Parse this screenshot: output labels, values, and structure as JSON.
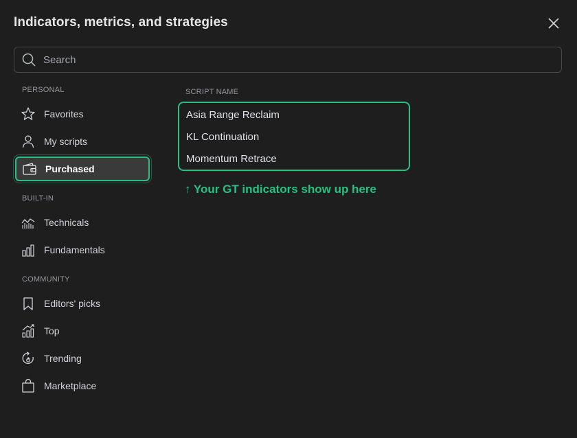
{
  "dialog": {
    "title": "Indicators, metrics, and strategies",
    "close_icon": "close-icon"
  },
  "search": {
    "placeholder": "Search",
    "value": ""
  },
  "sidebar": {
    "sections": [
      {
        "label": "PERSONAL",
        "items": [
          {
            "label": "Favorites",
            "icon": "star-icon"
          },
          {
            "label": "My scripts",
            "icon": "user-icon"
          },
          {
            "label": "Purchased",
            "icon": "wallet-icon",
            "active": true
          }
        ]
      },
      {
        "label": "BUILT-IN",
        "items": [
          {
            "label": "Technicals",
            "icon": "chart-line-icon"
          },
          {
            "label": "Fundamentals",
            "icon": "bar-chart-icon"
          }
        ]
      },
      {
        "label": "COMMUNITY",
        "items": [
          {
            "label": "Editors' picks",
            "icon": "bookmark-icon"
          },
          {
            "label": "Top",
            "icon": "trending-up-icon"
          },
          {
            "label": "Trending",
            "icon": "refresh-flame-icon"
          },
          {
            "label": "Marketplace",
            "icon": "shopping-bag-icon"
          }
        ]
      }
    ]
  },
  "main": {
    "column_header": "SCRIPT NAME",
    "scripts": [
      "Asia Range Reclaim",
      "KL Continuation",
      "Momentum Retrace"
    ],
    "hint": "↑ Your GT indicators show up here"
  },
  "colors": {
    "accent": "#26c281",
    "background": "#1e1e1e",
    "active_bg": "#3a3a3a"
  }
}
